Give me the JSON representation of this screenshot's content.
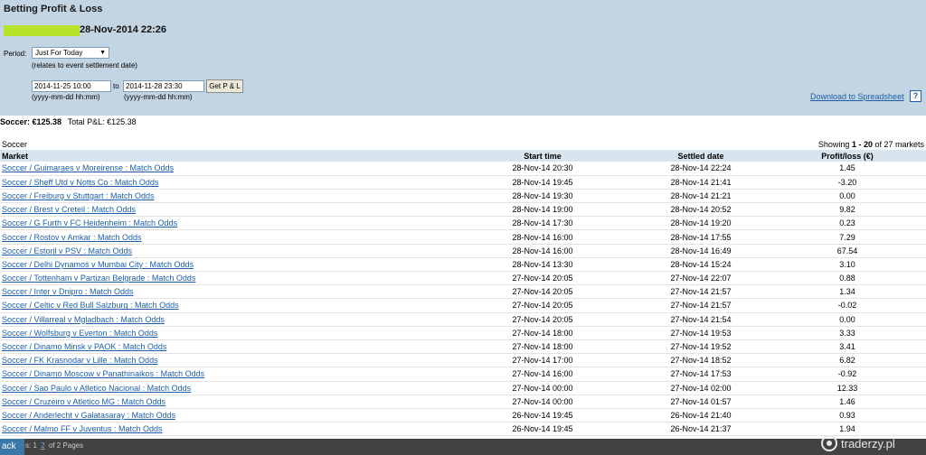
{
  "header": {
    "title": "Betting Profit & Loss",
    "datetime": "28-Nov-2014 22:26"
  },
  "filters": {
    "period_label": "Period:",
    "period_value": "Just For Today",
    "period_note": "(relates to event settlement date)",
    "from_value": "2014-11-25 10:00",
    "to_label": "to",
    "to_value": "2014-11-28 23:30",
    "from_hint": "(yyyy-mm-dd hh:mm)",
    "to_hint": "(yyyy-mm-dd hh:mm)",
    "button_label": "Get P & L"
  },
  "download": {
    "label": "Download to Spreadsheet",
    "help": "?"
  },
  "summary": {
    "sport_total": "Soccer: €125.38",
    "total_label": "Total P&L:",
    "total_value": "€125.38"
  },
  "section": {
    "label": "Soccer",
    "showing_prefix": "Showing",
    "showing_range": "1 - 20",
    "showing_suffix": "of 27 markets"
  },
  "table": {
    "columns": [
      "Market",
      "Start time",
      "Settled date",
      "Profit/loss (€)"
    ],
    "rows": [
      {
        "market": "Soccer / Guimaraes v Moreirense : Match Odds",
        "start": "28-Nov-14 20:30",
        "settled": "28-Nov-14 22:24",
        "pl": "1.45"
      },
      {
        "market": "Soccer / Sheff Utd v Notts Co : Match Odds",
        "start": "28-Nov-14 19:45",
        "settled": "28-Nov-14 21:41",
        "pl": "-3.20"
      },
      {
        "market": "Soccer / Freiburg v Stuttgart : Match Odds",
        "start": "28-Nov-14 19:30",
        "settled": "28-Nov-14 21:21",
        "pl": "0.00"
      },
      {
        "market": "Soccer / Brest v Creteil : Match Odds",
        "start": "28-Nov-14 19:00",
        "settled": "28-Nov-14 20:52",
        "pl": "9.82"
      },
      {
        "market": "Soccer / G Furth v FC Heidenheim : Match Odds",
        "start": "28-Nov-14 17:30",
        "settled": "28-Nov-14 19:20",
        "pl": "0.23"
      },
      {
        "market": "Soccer / Rostov v Amkar : Match Odds",
        "start": "28-Nov-14 16:00",
        "settled": "28-Nov-14 17:55",
        "pl": "7.29"
      },
      {
        "market": "Soccer / Estoril v PSV : Match Odds",
        "start": "28-Nov-14 16:00",
        "settled": "28-Nov-14 16:49",
        "pl": "67.54"
      },
      {
        "market": "Soccer / Delhi Dynamos v Mumbai City : Match Odds",
        "start": "28-Nov-14 13:30",
        "settled": "28-Nov-14 15:24",
        "pl": "3.10"
      },
      {
        "market": "Soccer / Tottenham v Partizan Belgrade : Match Odds",
        "start": "27-Nov-14 20:05",
        "settled": "27-Nov-14 22:07",
        "pl": "0.88"
      },
      {
        "market": "Soccer / Inter v Dnipro : Match Odds",
        "start": "27-Nov-14 20:05",
        "settled": "27-Nov-14 21:57",
        "pl": "1.34"
      },
      {
        "market": "Soccer / Celtic v Red Bull Salzburg : Match Odds",
        "start": "27-Nov-14 20:05",
        "settled": "27-Nov-14 21:57",
        "pl": "-0.02"
      },
      {
        "market": "Soccer / Villarreal v Mgladbach : Match Odds",
        "start": "27-Nov-14 20:05",
        "settled": "27-Nov-14 21:54",
        "pl": "0.00"
      },
      {
        "market": "Soccer / Wolfsburg v Everton : Match Odds",
        "start": "27-Nov-14 18:00",
        "settled": "27-Nov-14 19:53",
        "pl": "3.33"
      },
      {
        "market": "Soccer / Dinamo Minsk v PAOK : Match Odds",
        "start": "27-Nov-14 18:00",
        "settled": "27-Nov-14 19:52",
        "pl": "3.41"
      },
      {
        "market": "Soccer / FK Krasnodar v Lille : Match Odds",
        "start": "27-Nov-14 17:00",
        "settled": "27-Nov-14 18:52",
        "pl": "6.82"
      },
      {
        "market": "Soccer / Dinamo Moscow v Panathinaikos : Match Odds",
        "start": "27-Nov-14 16:00",
        "settled": "27-Nov-14 17:53",
        "pl": "-0.92"
      },
      {
        "market": "Soccer / Sao Paulo v Atletico Nacional : Match Odds",
        "start": "27-Nov-14 00:00",
        "settled": "27-Nov-14 02:00",
        "pl": "12.33"
      },
      {
        "market": "Soccer / Cruzeiro v Atletico MG : Match Odds",
        "start": "27-Nov-14 00:00",
        "settled": "27-Nov-14 01:57",
        "pl": "1.46"
      },
      {
        "market": "Soccer / Anderlecht v Galatasaray : Match Odds",
        "start": "26-Nov-14 19:45",
        "settled": "26-Nov-14 21:40",
        "pl": "0.93"
      },
      {
        "market": "Soccer / Malmo FF v Juventus : Match Odds",
        "start": "26-Nov-14 19:45",
        "settled": "26-Nov-14 21:37",
        "pl": "1.94"
      }
    ]
  },
  "pager": {
    "back_label": "ack",
    "prefix": "s:",
    "page1": "1",
    "page2": "2",
    "suffix": "of 2 Pages"
  },
  "watermark": {
    "text": "traderzy.pl",
    "icon": "traderzy-logo-icon"
  }
}
